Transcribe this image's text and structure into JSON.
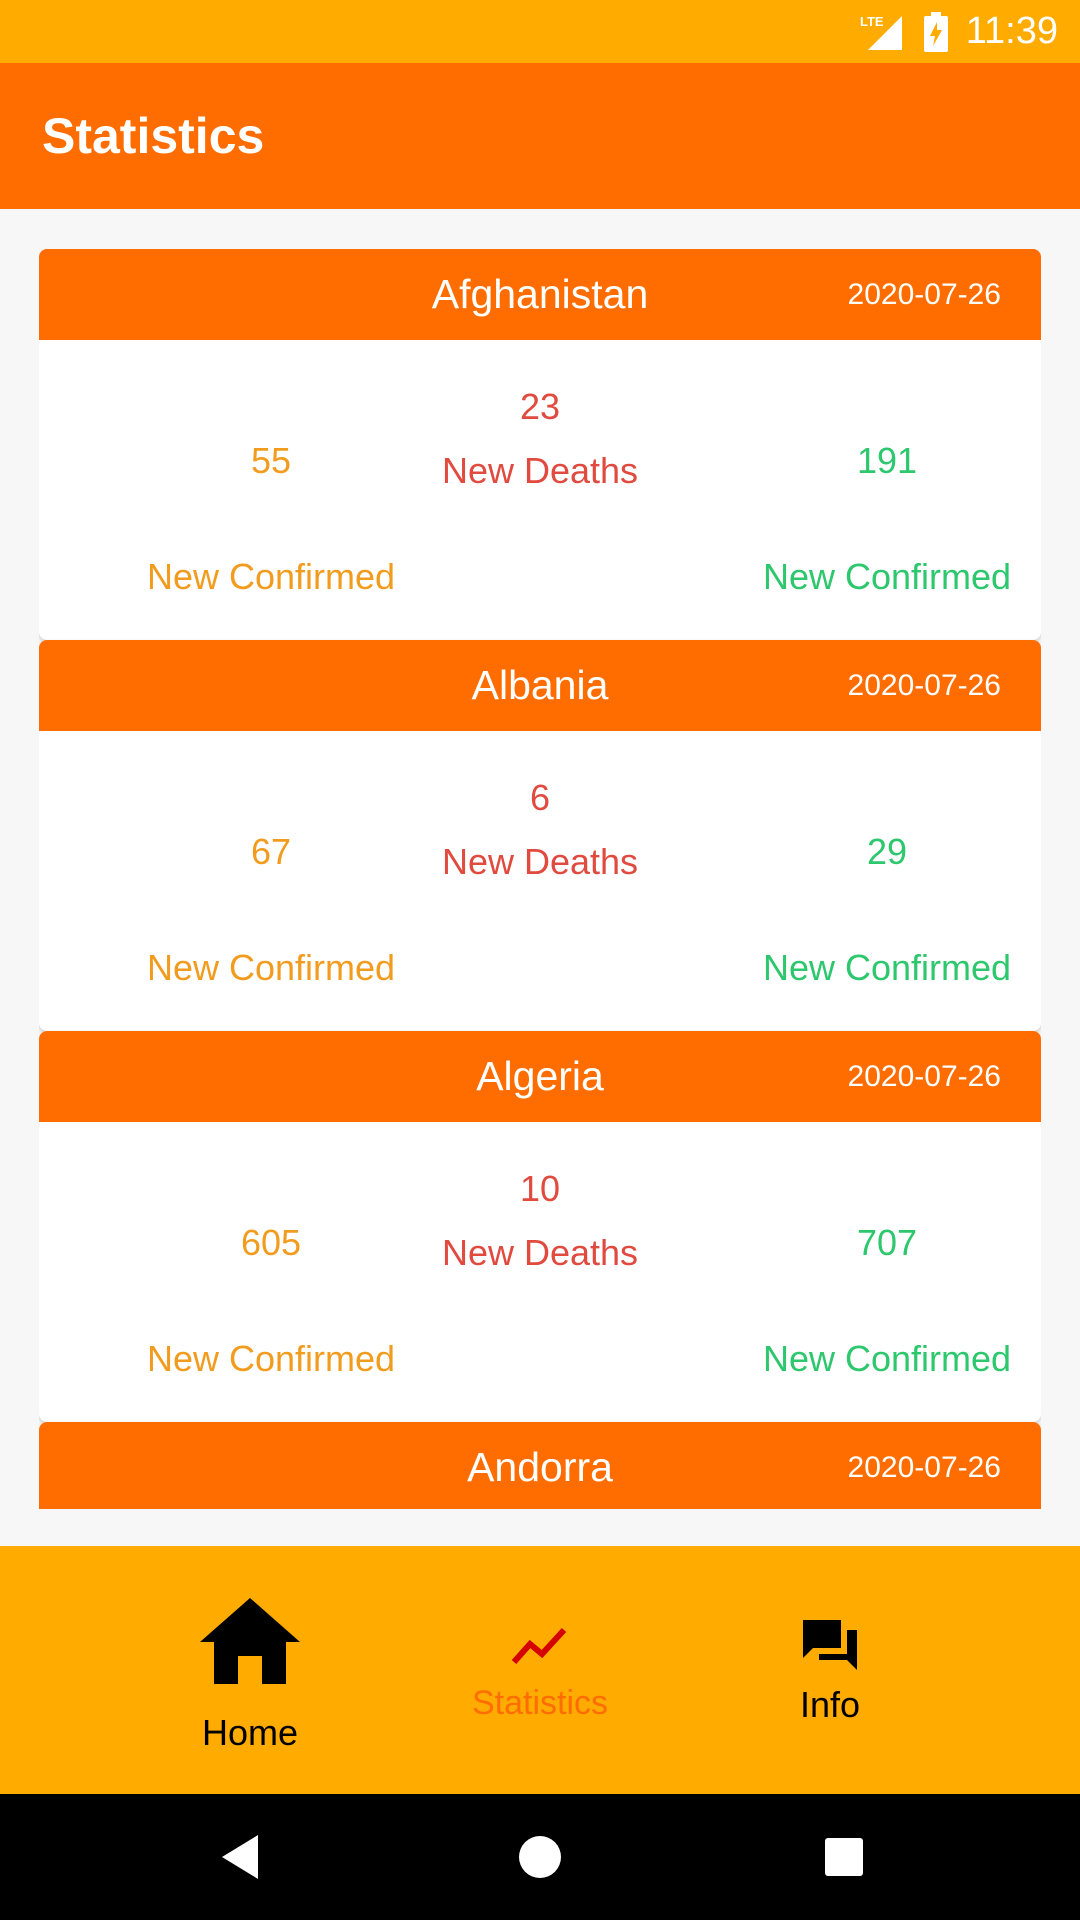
{
  "status_bar": {
    "network": "LTE",
    "time": "11:39"
  },
  "app_bar": {
    "title": "Statistics"
  },
  "cards": [
    {
      "country": "Afghanistan",
      "date": "2020-07-26",
      "left_value": "55",
      "left_label": "New Confirmed",
      "deaths_value": "23",
      "deaths_label": "New Deaths",
      "right_value": "191",
      "right_label": "New Confirmed"
    },
    {
      "country": "Albania",
      "date": "2020-07-26",
      "left_value": "67",
      "left_label": "New Confirmed",
      "deaths_value": "6",
      "deaths_label": "New Deaths",
      "right_value": "29",
      "right_label": "New Confirmed"
    },
    {
      "country": "Algeria",
      "date": "2020-07-26",
      "left_value": "605",
      "left_label": "New Confirmed",
      "deaths_value": "10",
      "deaths_label": "New Deaths",
      "right_value": "707",
      "right_label": "New Confirmed"
    },
    {
      "country": "Andorra",
      "date": "2020-07-26"
    }
  ],
  "bottom_nav": {
    "items": [
      {
        "label": "Home",
        "icon": "home-icon"
      },
      {
        "label": "Statistics",
        "icon": "trending-icon",
        "active": true
      },
      {
        "label": "Info",
        "icon": "forum-icon"
      }
    ],
    "active_color": "#FF6D00"
  },
  "colors": {
    "status_bar": "#FFAB00",
    "app_bar": "#FF6D00",
    "confirmed": "#F29C1F",
    "deaths": "#E04A3F",
    "recovered": "#2DC76D"
  }
}
